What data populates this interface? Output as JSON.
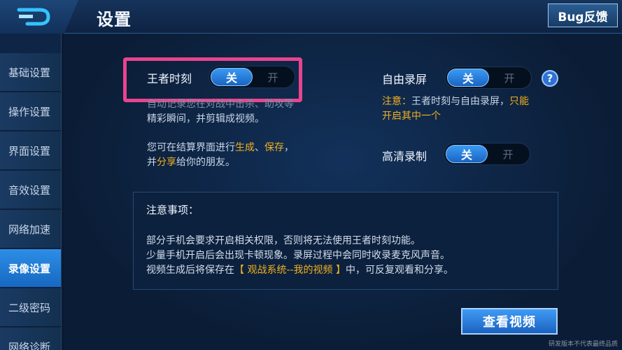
{
  "header": {
    "title": "设置",
    "bug_button": "Bug反馈"
  },
  "sidebar": {
    "items": [
      {
        "label": "基础设置"
      },
      {
        "label": "操作设置"
      },
      {
        "label": "界面设置"
      },
      {
        "label": "音效设置"
      },
      {
        "label": "网络加速"
      },
      {
        "label": "录像设置"
      },
      {
        "label": "二级密码"
      },
      {
        "label": "网络诊断"
      }
    ],
    "active_item": "录像设置"
  },
  "settings": {
    "king_moment": {
      "label": "王者时刻",
      "on_label": "关",
      "off_label": "开",
      "desc_line1": "自动记录您在对战中击杀、助攻等",
      "desc_line2": "精彩瞬间，并剪辑成视频。",
      "desc2_line1_a": "您可在结算界面进行",
      "desc2_line1_b": "生成",
      "desc2_line1_c": "、",
      "desc2_line1_d": "保存",
      "desc2_line1_e": "，",
      "desc2_line2_a": "并",
      "desc2_line2_b": "分享",
      "desc2_line2_c": "给你的朋友。"
    },
    "free_record": {
      "label": "自由录屏",
      "on_label": "关",
      "off_label": "开",
      "help_icon": "?",
      "note_line1_a": "注意：",
      "note_line1_b": "王者时刻与自由录屏，",
      "note_line1_c": "只能",
      "note_line2": "开启其中一个"
    },
    "hd_record": {
      "label": "高清录制",
      "on_label": "关",
      "off_label": "开"
    }
  },
  "notice": {
    "title": "注意事项：",
    "line1": "部分手机会要求开启相关权限，否则将无法使用王者时刻功能。",
    "line2": "少量手机开启后会出现卡顿现象。录屏过程中会同时收录麦克风声音。",
    "line3_a": "视频生成后将保存在",
    "line3_b": "【 观战系统--我的视频 】",
    "line3_c": "中，可反复观看和分享。"
  },
  "view_button": "查看视频",
  "watermark": "研发版本不代表最终品质",
  "colors": {
    "accent_blue": "#2d8ee6",
    "highlight_orange": "#f2b01e",
    "annotation_pink": "#e8448f"
  }
}
